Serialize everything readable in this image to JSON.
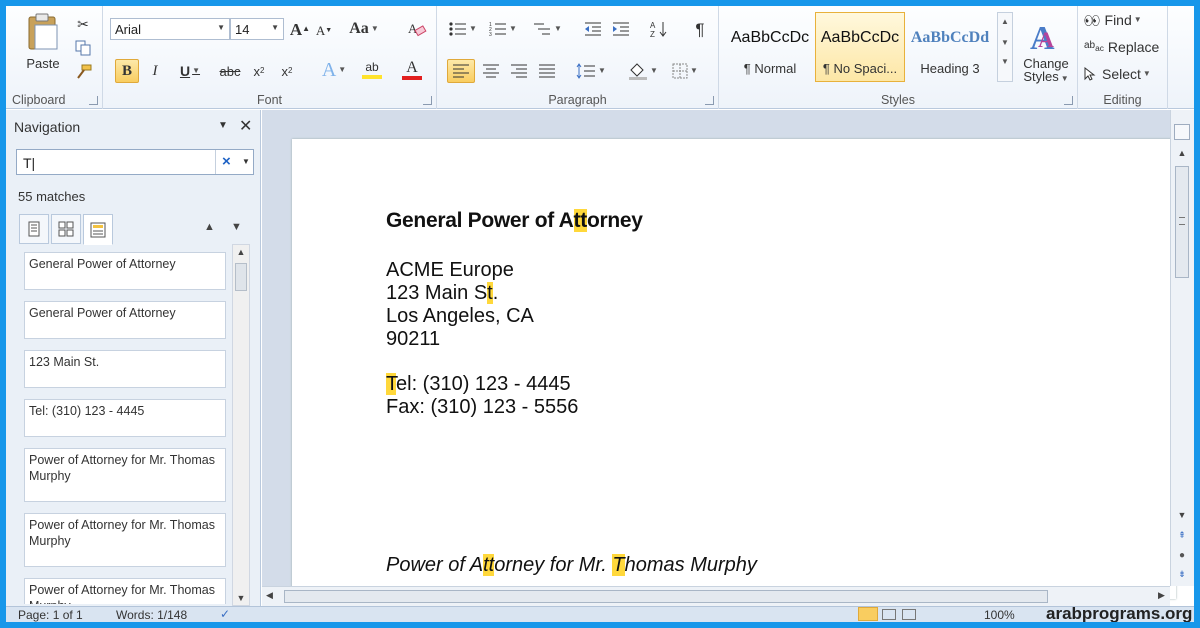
{
  "ribbon": {
    "clipboard": {
      "label": "Clipboard",
      "paste_label": "Paste"
    },
    "font": {
      "label": "Font",
      "font_name": "Arial",
      "font_size": "14",
      "change_case": "Aa"
    },
    "paragraph": {
      "label": "Paragraph"
    },
    "styles": {
      "label": "Styles",
      "items": [
        {
          "preview": "AaBbCcDc",
          "name": "¶ Normal"
        },
        {
          "preview": "AaBbCcDc",
          "name": "¶ No Spaci..."
        },
        {
          "preview": "AaBbCcDd",
          "name": "Heading 3"
        }
      ],
      "change_styles_line1": "Change",
      "change_styles_line2": "Styles"
    },
    "editing": {
      "label": "Editing",
      "find": "Find",
      "replace": "Replace",
      "select": "Select"
    }
  },
  "navigation": {
    "title": "Navigation",
    "search_value": "T|",
    "matches": "55 matches",
    "results": [
      "General Power of Attorney",
      "General Power of Attorney",
      "123 Main St.",
      "Tel: (310) 123 - 4445",
      "Power of Attorney for Mr. Thomas Murphy",
      "Power of Attorney for Mr. Thomas Murphy",
      "Power of Attorney for Mr. Thomas Murphy"
    ]
  },
  "document": {
    "title_parts": [
      "General Power of A",
      "tt",
      "orney"
    ],
    "company": "ACME Europe",
    "street_parts": [
      "123 Main S",
      "t",
      "."
    ],
    "city": "Los Angeles, CA",
    "zip": "90211",
    "tel_parts": [
      "T",
      "el: (310) 123 - 4445"
    ],
    "fax": "Fax: (310) 123 - 5556",
    "poa_parts": [
      "Power of A",
      "tt",
      "orney for Mr. ",
      "T",
      "homas Murphy"
    ]
  },
  "status": {
    "page": "Page: 1 of 1",
    "words": "Words: 1/148",
    "zoom": "100%"
  },
  "watermark": "arabprograms.org",
  "colors": {
    "highlight": "#ffd83b",
    "accent": "#1797ea",
    "ribbon_selected": "#f9cd60"
  }
}
